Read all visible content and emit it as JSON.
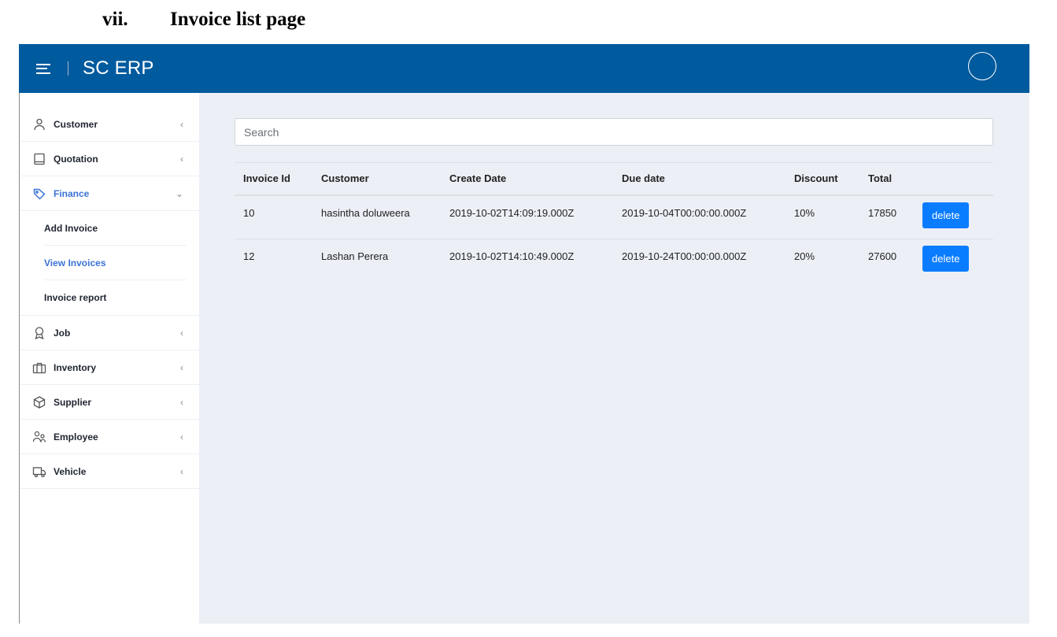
{
  "doc": {
    "number": "vii.",
    "title": "Invoice list page"
  },
  "header": {
    "brand": "SC ERP",
    "menu_icon": "hamburger-icon",
    "avatar_icon": "user-avatar-circle"
  },
  "colors": {
    "topbar": "#005a9e",
    "accent": "#3b73d6",
    "delete_button": "#0a7cff",
    "content_bg": "#eceff6"
  },
  "sidebar": {
    "items": [
      {
        "label": "Customer",
        "icon": "user-icon"
      },
      {
        "label": "Quotation",
        "icon": "book-icon"
      },
      {
        "label": "Finance",
        "icon": "tag-icon",
        "active": true,
        "expanded": true,
        "children": [
          {
            "label": "Add Invoice"
          },
          {
            "label": "View Invoices",
            "active": true
          },
          {
            "label": "Invoice report"
          }
        ]
      },
      {
        "label": "Job",
        "icon": "award-icon"
      },
      {
        "label": "Inventory",
        "icon": "briefcase-icon"
      },
      {
        "label": "Supplier",
        "icon": "box-icon"
      },
      {
        "label": "Employee",
        "icon": "users-icon"
      },
      {
        "label": "Vehicle",
        "icon": "truck-icon"
      }
    ]
  },
  "search": {
    "placeholder": "Search",
    "value": ""
  },
  "table": {
    "headers": [
      "Invoice Id",
      "Customer",
      "Create Date",
      "Due date",
      "Discount",
      "Total",
      ""
    ],
    "rows": [
      {
        "id": "10",
        "customer": "hasintha doluweera",
        "create_date": "2019-10-02T14:09:19.000Z",
        "due_date": "2019-10-04T00:00:00.000Z",
        "discount": "10%",
        "total": "17850",
        "action": "delete"
      },
      {
        "id": "12",
        "customer": "Lashan Perera",
        "create_date": "2019-10-02T14:10:49.000Z",
        "due_date": "2019-10-24T00:00:00.000Z",
        "discount": "20%",
        "total": "27600",
        "action": "delete"
      }
    ]
  }
}
